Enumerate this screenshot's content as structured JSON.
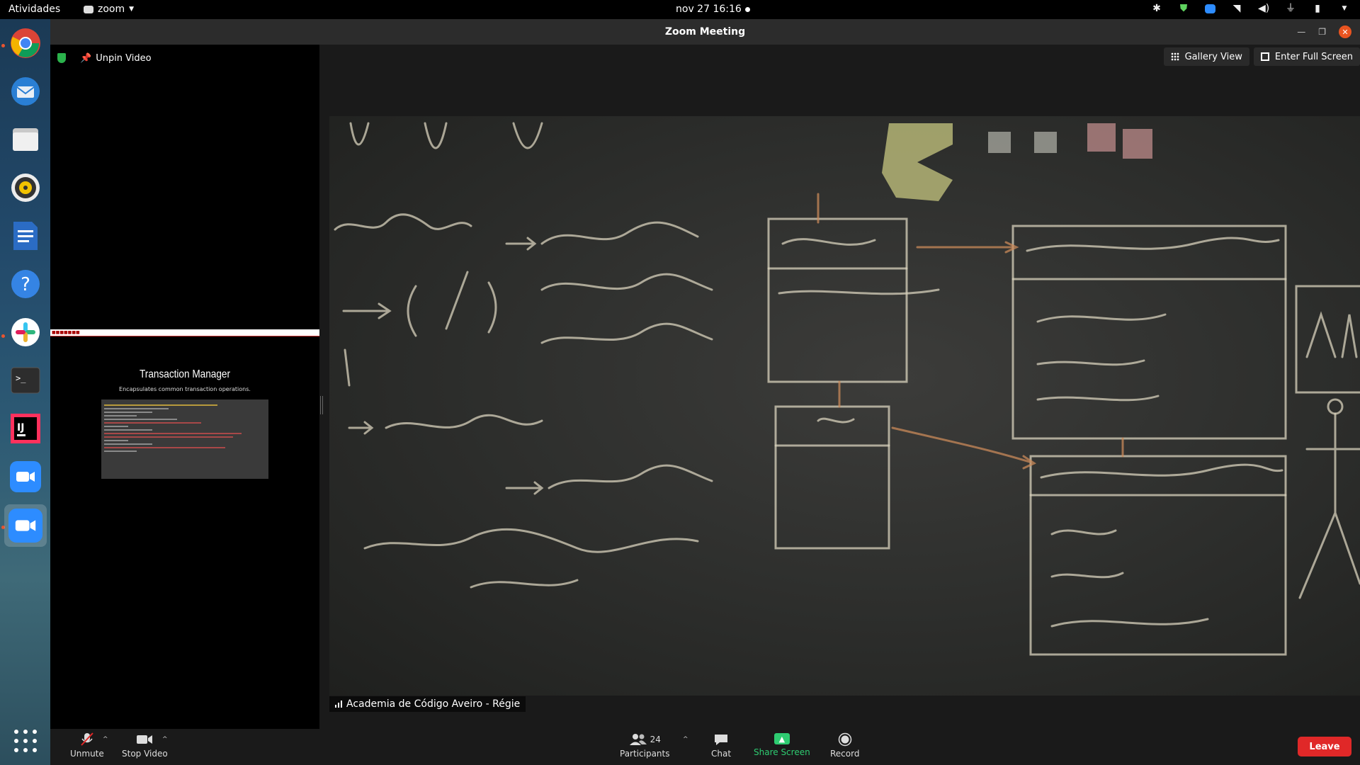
{
  "topbar": {
    "activities": "Atividades",
    "app_name": "zoom",
    "clock": "nov 27  16:16"
  },
  "window": {
    "title": "Zoom Meeting"
  },
  "left_panel": {
    "unpin_label": "Unpin Video",
    "slide_title": "Transaction Manager",
    "slide_subtitle": "Encapsulates common transaction operations."
  },
  "view_controls": {
    "gallery_label": "Gallery View",
    "fullscreen_label": "Enter Full Screen"
  },
  "video": {
    "participant_name": "Academia de Código Aveiro - Régie"
  },
  "toolbar": {
    "unmute": "Unmute",
    "stop_video": "Stop Video",
    "participants_count": "24",
    "participants": "Participants",
    "chat": "Chat",
    "share_screen": "Share Screen",
    "record": "Record",
    "leave": "Leave"
  },
  "dock": {
    "items": [
      "chrome-icon",
      "thunderbird-icon",
      "files-icon",
      "rhythmbox-icon",
      "writer-icon",
      "help-icon",
      "slack-icon",
      "terminal-icon",
      "intellij-icon",
      "zoom-icon",
      "zoom-meeting-icon"
    ]
  },
  "colors": {
    "leave": "#e02828",
    "share": "#2ecc71",
    "accent_close": "#e95420"
  }
}
